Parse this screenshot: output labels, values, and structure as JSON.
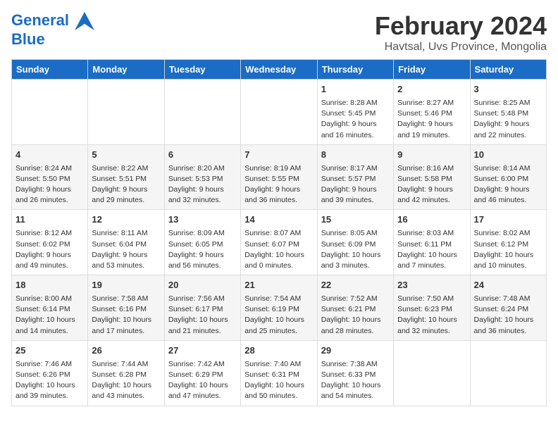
{
  "logo": {
    "line1": "General",
    "line2": "Blue"
  },
  "title": "February 2024",
  "subtitle": "Havtsal, Uvs Province, Mongolia",
  "days_header": [
    "Sunday",
    "Monday",
    "Tuesday",
    "Wednesday",
    "Thursday",
    "Friday",
    "Saturday"
  ],
  "rows": [
    [
      {
        "num": "",
        "info": ""
      },
      {
        "num": "",
        "info": ""
      },
      {
        "num": "",
        "info": ""
      },
      {
        "num": "",
        "info": ""
      },
      {
        "num": "1",
        "info": "Sunrise: 8:28 AM\nSunset: 5:45 PM\nDaylight: 9 hours\nand 16 minutes."
      },
      {
        "num": "2",
        "info": "Sunrise: 8:27 AM\nSunset: 5:46 PM\nDaylight: 9 hours\nand 19 minutes."
      },
      {
        "num": "3",
        "info": "Sunrise: 8:25 AM\nSunset: 5:48 PM\nDaylight: 9 hours\nand 22 minutes."
      }
    ],
    [
      {
        "num": "4",
        "info": "Sunrise: 8:24 AM\nSunset: 5:50 PM\nDaylight: 9 hours\nand 26 minutes."
      },
      {
        "num": "5",
        "info": "Sunrise: 8:22 AM\nSunset: 5:51 PM\nDaylight: 9 hours\nand 29 minutes."
      },
      {
        "num": "6",
        "info": "Sunrise: 8:20 AM\nSunset: 5:53 PM\nDaylight: 9 hours\nand 32 minutes."
      },
      {
        "num": "7",
        "info": "Sunrise: 8:19 AM\nSunset: 5:55 PM\nDaylight: 9 hours\nand 36 minutes."
      },
      {
        "num": "8",
        "info": "Sunrise: 8:17 AM\nSunset: 5:57 PM\nDaylight: 9 hours\nand 39 minutes."
      },
      {
        "num": "9",
        "info": "Sunrise: 8:16 AM\nSunset: 5:58 PM\nDaylight: 9 hours\nand 42 minutes."
      },
      {
        "num": "10",
        "info": "Sunrise: 8:14 AM\nSunset: 6:00 PM\nDaylight: 9 hours\nand 46 minutes."
      }
    ],
    [
      {
        "num": "11",
        "info": "Sunrise: 8:12 AM\nSunset: 6:02 PM\nDaylight: 9 hours\nand 49 minutes."
      },
      {
        "num": "12",
        "info": "Sunrise: 8:11 AM\nSunset: 6:04 PM\nDaylight: 9 hours\nand 53 minutes."
      },
      {
        "num": "13",
        "info": "Sunrise: 8:09 AM\nSunset: 6:05 PM\nDaylight: 9 hours\nand 56 minutes."
      },
      {
        "num": "14",
        "info": "Sunrise: 8:07 AM\nSunset: 6:07 PM\nDaylight: 10 hours\nand 0 minutes."
      },
      {
        "num": "15",
        "info": "Sunrise: 8:05 AM\nSunset: 6:09 PM\nDaylight: 10 hours\nand 3 minutes."
      },
      {
        "num": "16",
        "info": "Sunrise: 8:03 AM\nSunset: 6:11 PM\nDaylight: 10 hours\nand 7 minutes."
      },
      {
        "num": "17",
        "info": "Sunrise: 8:02 AM\nSunset: 6:12 PM\nDaylight: 10 hours\nand 10 minutes."
      }
    ],
    [
      {
        "num": "18",
        "info": "Sunrise: 8:00 AM\nSunset: 6:14 PM\nDaylight: 10 hours\nand 14 minutes."
      },
      {
        "num": "19",
        "info": "Sunrise: 7:58 AM\nSunset: 6:16 PM\nDaylight: 10 hours\nand 17 minutes."
      },
      {
        "num": "20",
        "info": "Sunrise: 7:56 AM\nSunset: 6:17 PM\nDaylight: 10 hours\nand 21 minutes."
      },
      {
        "num": "21",
        "info": "Sunrise: 7:54 AM\nSunset: 6:19 PM\nDaylight: 10 hours\nand 25 minutes."
      },
      {
        "num": "22",
        "info": "Sunrise: 7:52 AM\nSunset: 6:21 PM\nDaylight: 10 hours\nand 28 minutes."
      },
      {
        "num": "23",
        "info": "Sunrise: 7:50 AM\nSunset: 6:23 PM\nDaylight: 10 hours\nand 32 minutes."
      },
      {
        "num": "24",
        "info": "Sunrise: 7:48 AM\nSunset: 6:24 PM\nDaylight: 10 hours\nand 36 minutes."
      }
    ],
    [
      {
        "num": "25",
        "info": "Sunrise: 7:46 AM\nSunset: 6:26 PM\nDaylight: 10 hours\nand 39 minutes."
      },
      {
        "num": "26",
        "info": "Sunrise: 7:44 AM\nSunset: 6:28 PM\nDaylight: 10 hours\nand 43 minutes."
      },
      {
        "num": "27",
        "info": "Sunrise: 7:42 AM\nSunset: 6:29 PM\nDaylight: 10 hours\nand 47 minutes."
      },
      {
        "num": "28",
        "info": "Sunrise: 7:40 AM\nSunset: 6:31 PM\nDaylight: 10 hours\nand 50 minutes."
      },
      {
        "num": "29",
        "info": "Sunrise: 7:38 AM\nSunset: 6:33 PM\nDaylight: 10 hours\nand 54 minutes."
      },
      {
        "num": "",
        "info": ""
      },
      {
        "num": "",
        "info": ""
      }
    ]
  ]
}
